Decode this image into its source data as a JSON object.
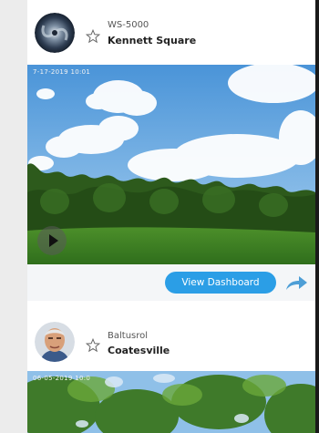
{
  "stations": [
    {
      "name": "WS-5000",
      "location": "Kennett Square",
      "camera_stamp": "7-17-2019 10:01",
      "action_label": "View Dashboard"
    },
    {
      "name": "Baltusrol",
      "location": "Coatesville",
      "camera_stamp": "06-05-2019 10:0"
    }
  ],
  "colors": {
    "accent": "#2b9ee6",
    "share_arrow": "#4d9ed6",
    "card_footer": "#f4f6f8"
  },
  "icons": {
    "favorite": "star-outline-icon",
    "play": "play-icon",
    "share": "share-arrow-icon"
  }
}
